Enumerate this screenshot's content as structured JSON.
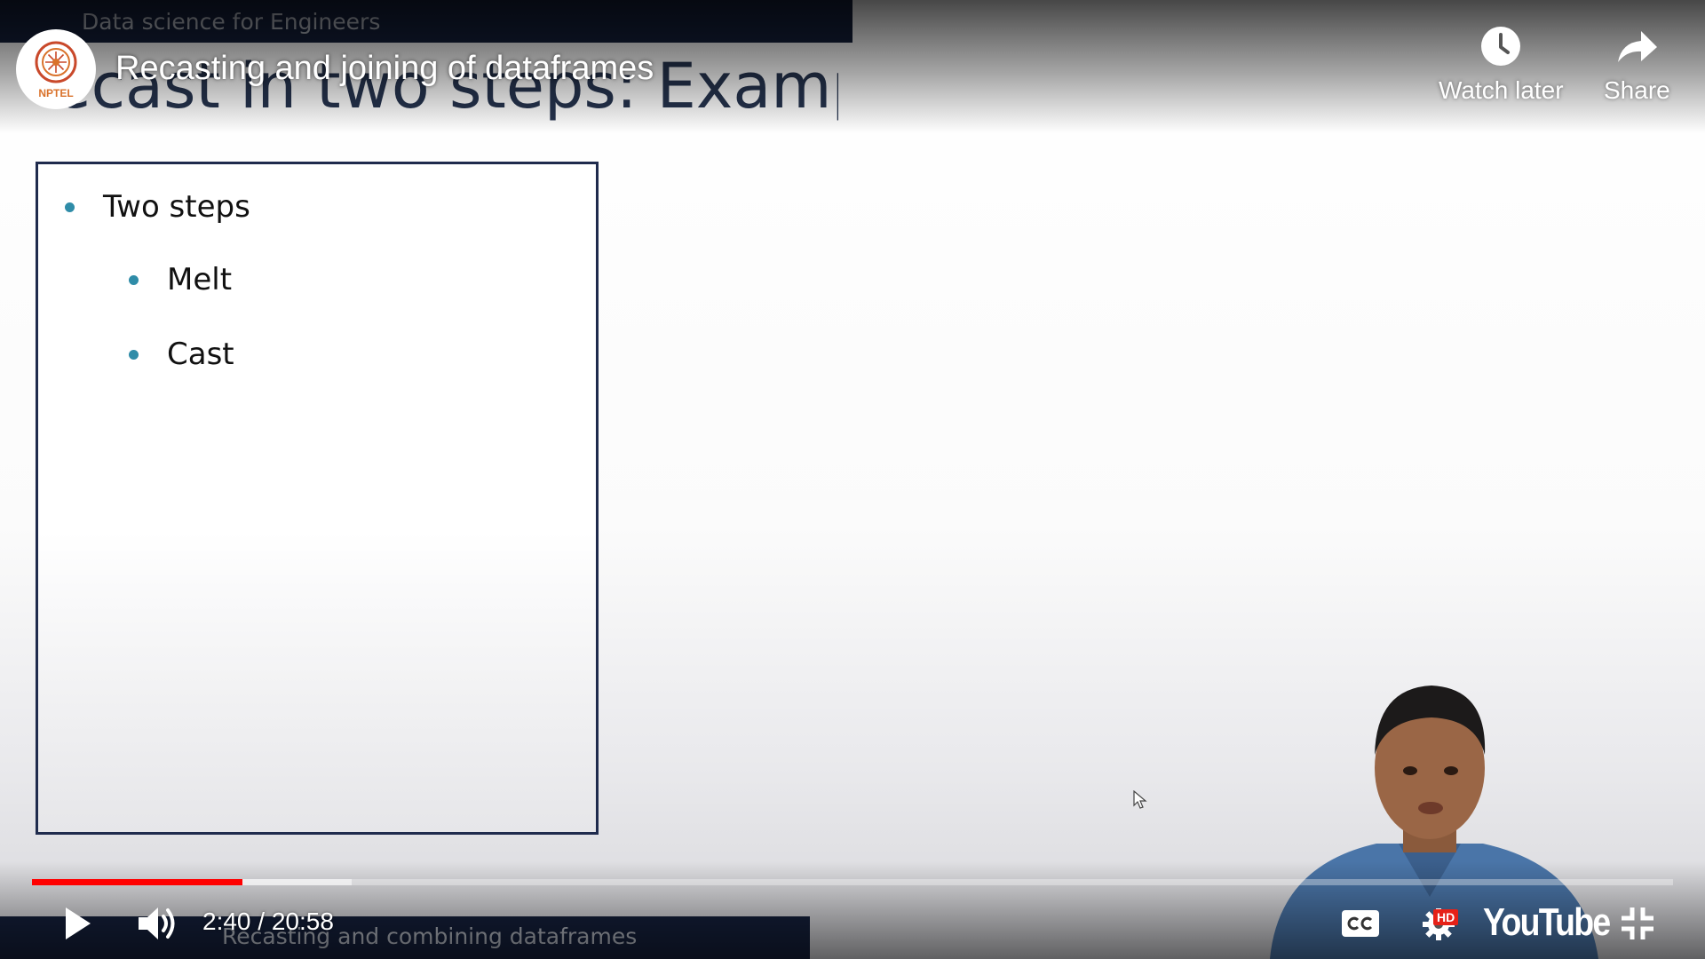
{
  "slide": {
    "course_title": "Data science for Engineers",
    "heading_visible": "ecast in two steps: Example",
    "bullets": [
      {
        "text": "Two steps",
        "level": 1
      },
      {
        "text": "Melt",
        "level": 2
      },
      {
        "text": "Cast",
        "level": 2
      }
    ],
    "lower_title": "Recasting and combining dataframes",
    "accent_color": "#2f8ca8",
    "band_color": "#15203c"
  },
  "player": {
    "channel": "NPTEL",
    "video_title": "Recasting and joining of dataframes",
    "watch_later_label": "Watch later",
    "share_label": "Share",
    "current_time": "2:40",
    "duration": "20:58",
    "time_text": "2:40 / 20:58",
    "played_fraction": 0.128,
    "buffered_fraction": 0.195,
    "hd_badge": "HD",
    "brand_logo": "YouTube",
    "progress_color": "#ff0000",
    "icons": [
      "play-icon",
      "volume-icon",
      "cc-icon",
      "gear-icon",
      "fullscreen-exit-icon",
      "clock-icon",
      "share-arrow-icon"
    ]
  }
}
